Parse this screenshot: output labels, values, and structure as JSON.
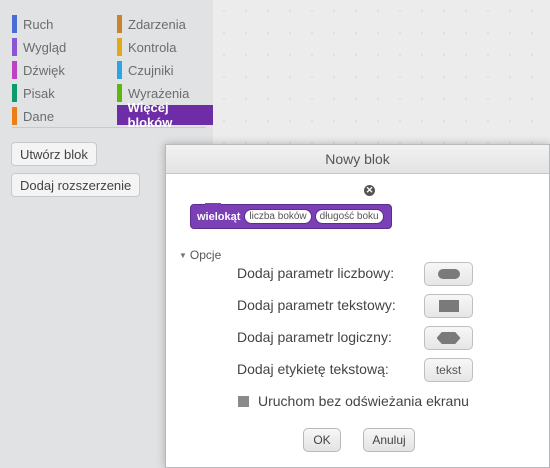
{
  "palette": {
    "categories_left": [
      {
        "label": "Ruch",
        "color": "#4a6cd4"
      },
      {
        "label": "Wygląd",
        "color": "#8a55d7"
      },
      {
        "label": "Dźwięk",
        "color": "#bb42c3"
      },
      {
        "label": "Pisak",
        "color": "#0e9a6c"
      },
      {
        "label": "Dane",
        "color": "#ee7d16"
      }
    ],
    "categories_right": [
      {
        "label": "Zdarzenia",
        "color": "#c88330"
      },
      {
        "label": "Kontrola",
        "color": "#e1a91a"
      },
      {
        "label": "Czujniki",
        "color": "#2ca5e2"
      },
      {
        "label": "Wyrażenia",
        "color": "#5cb712"
      },
      {
        "label": "Więcej bloków",
        "color": "#632d99",
        "selected": true
      }
    ],
    "make_block_label": "Utwórz blok",
    "add_extension_label": "Dodaj rozszerzenie"
  },
  "dialog": {
    "title": "Nowy blok",
    "close_icon": "close-icon",
    "block": {
      "name": "wielokąt",
      "params": [
        "liczba boków",
        "długość boku"
      ],
      "color": "#7b3fb6"
    },
    "options_label": "Opcje",
    "rows": [
      {
        "label": "Dodaj parametr liczbowy:",
        "icon": "number-param-icon"
      },
      {
        "label": "Dodaj parametr tekstowy:",
        "icon": "text-param-icon"
      },
      {
        "label": "Dodaj parametr logiczny:",
        "icon": "boolean-param-icon"
      },
      {
        "label": "Dodaj etykietę tekstową:",
        "button_text": "tekst"
      }
    ],
    "run_without_refresh": "Uruchom bez odświeżania ekranu",
    "ok_label": "OK",
    "cancel_label": "Anuluj"
  }
}
